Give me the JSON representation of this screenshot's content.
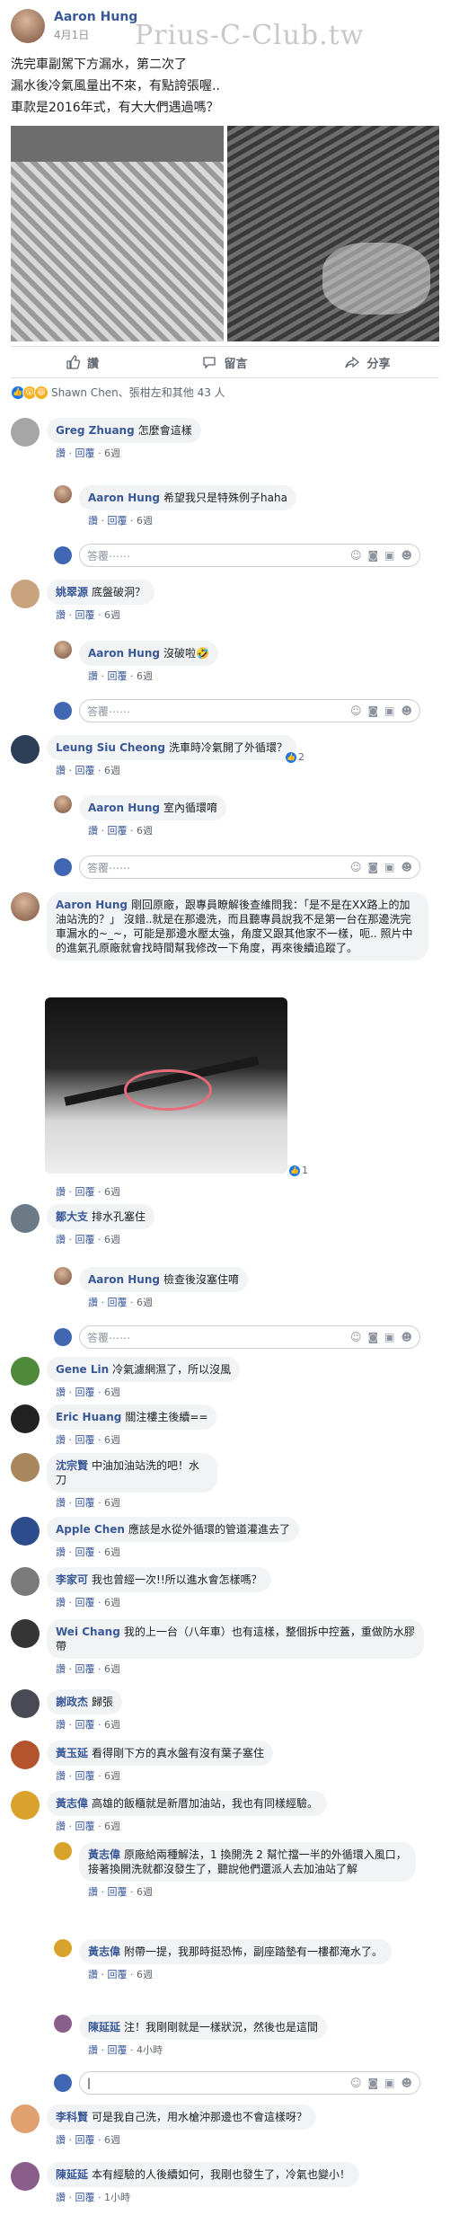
{
  "watermark": "Prius-C-Club.tw",
  "post": {
    "author": "Aaron Hung",
    "date": "4月1日",
    "lines": [
      "洗完車副駕下方漏水，第二次了",
      "漏水後冷氣風量出不來，有點誇張喔..",
      "車款是2016年式，有大大們遇過嗎？"
    ],
    "actions": {
      "like": "讚",
      "comment": "留言",
      "share": "分享"
    },
    "reactions_text": "Shawn Chen、張柑左和其他 43 人"
  },
  "labels": {
    "like": "讚",
    "reply": "回覆",
    "reply_placeholder": "答覆⋯⋯"
  },
  "comments": [
    {
      "name": "Greg Zhuang",
      "text": "怎麼會這樣",
      "time": "6週"
    },
    {
      "name": "Aaron Hung",
      "text": "希望我只是特殊例子haha",
      "time": "6週"
    },
    {
      "name": "姚翠源",
      "text": "底盤破洞？",
      "time": "6週"
    },
    {
      "name": "Aaron Hung",
      "text": "沒破啦🤣",
      "time": "6週"
    },
    {
      "name": "Leung Siu Cheong",
      "text": "洗車時冷氣開了外循環？",
      "time": "6週",
      "likes": "2"
    },
    {
      "name": "Aaron Hung",
      "text": "室內循環唷",
      "time": "6週"
    },
    {
      "name": "Aaron Hung",
      "text": "剛回原廠，跟專員瞭解後查維問我：「是不是在XX路上的加油站洗的？」 沒錯..就是在那邊洗，而且聽專員說我不是第一台在那邊洗完車漏水的~_~，可能是那邊水壓太強，角度又跟其他家不一樣，呃.. 照片中的進氣孔原廠就會找時間幫我修改一下角度，再來後續追蹤了。",
      "time": "6週",
      "likes": "1"
    },
    {
      "name": "鄒大支",
      "text": "排水孔塞住",
      "time": "6週"
    },
    {
      "name": "Aaron Hung",
      "text": "檢查後沒塞住唷",
      "time": "6週"
    },
    {
      "name": "Gene Lin",
      "text": "冷氣濾網濕了，所以沒風",
      "time": "6週"
    },
    {
      "name": "Eric Huang",
      "text": "關注樓主後續==",
      "time": "6週"
    },
    {
      "name": "沈宗賢",
      "text": "中油加油站洗的吧！水刀",
      "time": "6週"
    },
    {
      "name": "Apple Chen",
      "text": "應該是水從外循環的管道灌進去了",
      "time": "6週"
    },
    {
      "name": "李家可",
      "text": "我也曾經一次!!所以進水會怎樣嗎？",
      "time": "6週"
    },
    {
      "name": "Wei Chang",
      "text": "我的上一台（八年車）也有這樣，整個拆中控蓋，重做防水膠帶",
      "time": "6週"
    },
    {
      "name": "謝政杰",
      "text": "歸張",
      "time": "6週"
    },
    {
      "name": "黃玉延",
      "text": "看得剛下方的真水盤有沒有葉子塞住",
      "time": "6週"
    },
    {
      "name": "黃志偉",
      "text": "高雄的飯櫃就是新厝加油站，我也有同樣經驗。",
      "time": "6週"
    },
    {
      "name": "黃志偉",
      "text": "原廠給兩種解法，1 換開洗 2 幫忙擋一半的外循環入風口，接著換開洗就都沒發生了，聽說他們還派人去加油站了解",
      "time": "6週"
    },
    {
      "name": "黃志偉",
      "text": "附帶一提，我那時挺恐怖，副座踏墊有一樓都淹水了。",
      "time": "6週"
    },
    {
      "name": "陳延延",
      "text": "注！我剛剛就是一樣狀況，然後也是這間",
      "time": "4小時"
    },
    {
      "name": "李科賢",
      "text": "可是我自己洗，用水槍沖那邊也不會這樣呀？",
      "time": "6週"
    },
    {
      "name": "陳延延",
      "text": "本有經驗的人後續如何，我剛也發生了，冷氣也變小！",
      "time": "1小時"
    }
  ]
}
